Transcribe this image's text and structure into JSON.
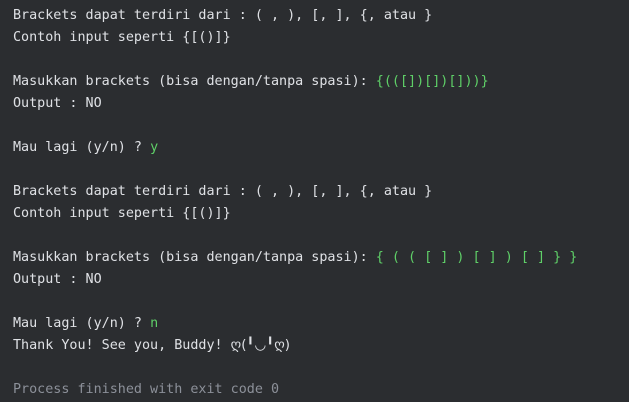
{
  "colors": {
    "background": "#2b2d30",
    "stdout": "#dfe1e5",
    "user_input": "#5fd068",
    "system_message": "#8c9099"
  },
  "console": {
    "session1": {
      "info_line": "Brackets dapat terdiri dari : ( , ), [, ], {, atau }",
      "example_line": "Contoh input seperti {[()]}",
      "prompt": "Masukkan brackets (bisa dengan/tanpa spasi): ",
      "input": "{(([])[])[]))}",
      "output": "Output : NO",
      "again_prompt": "Mau lagi (y/n) ? ",
      "again_answer": "y"
    },
    "session2": {
      "info_line": "Brackets dapat terdiri dari : ( , ), [, ], {, atau }",
      "example_line": "Contoh input seperti {[()]}",
      "prompt": "Masukkan brackets (bisa dengan/tanpa spasi): ",
      "input": "{ ( ( [ ] ) [ ] ) [ ] } }",
      "output": "Output : NO",
      "again_prompt": "Mau lagi (y/n) ? ",
      "again_answer": "n"
    },
    "farewell_text": "Thank You! See you, Buddy! ",
    "farewell_kaomoji": "ღ(╹◡╹ღ)",
    "exit_message": "Process finished with exit code 0"
  }
}
